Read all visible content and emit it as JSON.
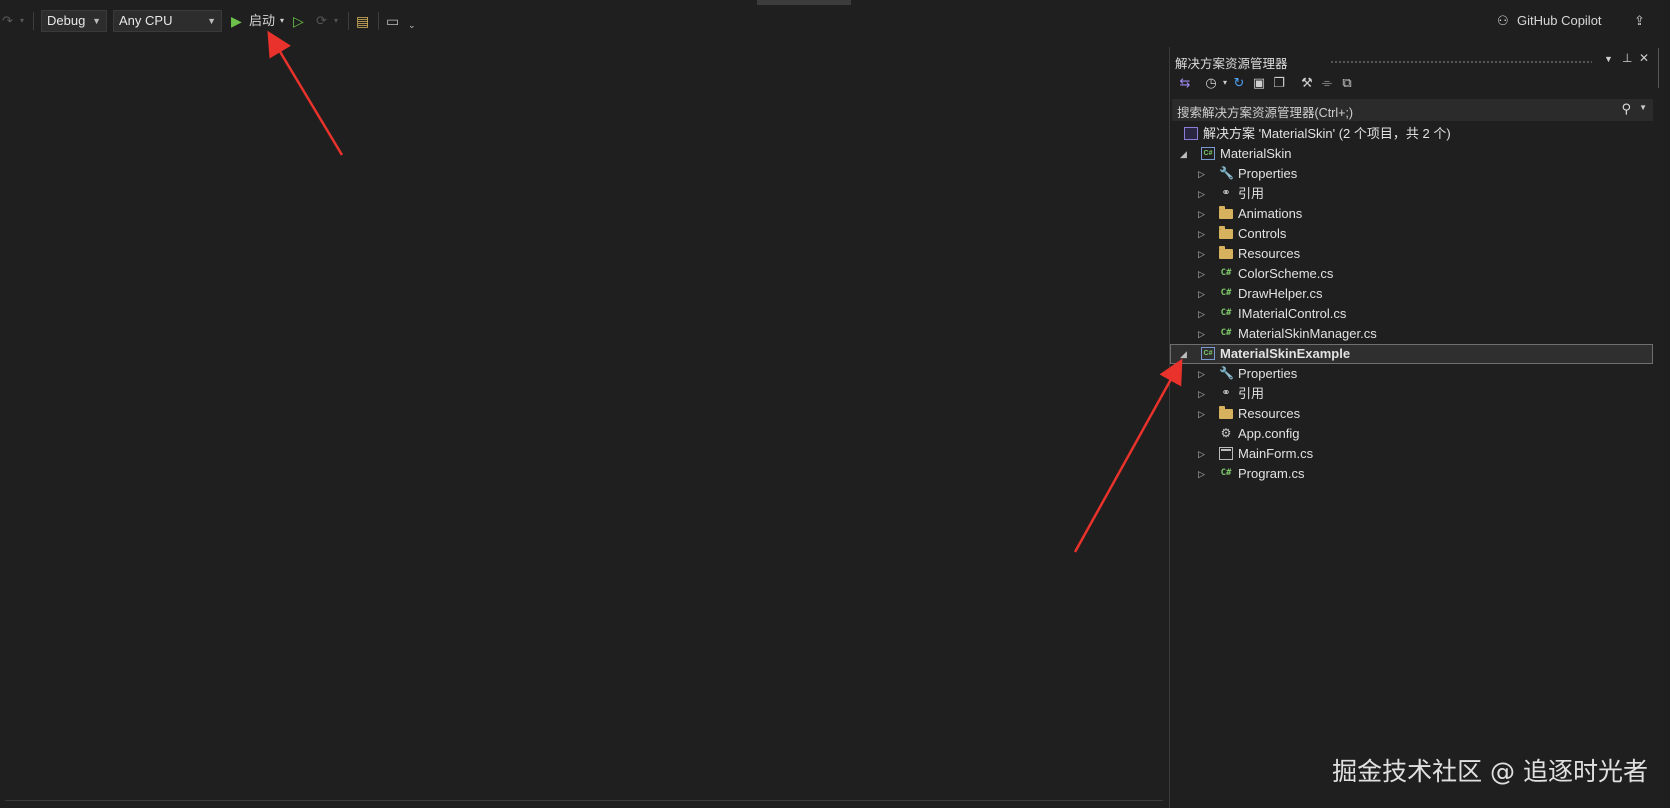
{
  "toolbar": {
    "config_select": "Debug",
    "platform_select": "Any CPU",
    "start_label": "启动",
    "copilot_label": "GitHub Copilot"
  },
  "solution_explorer": {
    "title": "解决方案资源管理器",
    "search_placeholder": "搜索解决方案资源管理器(Ctrl+;)",
    "tree": [
      {
        "label": "解决方案 'MaterialSkin' (2 个项目，共 2 个)",
        "icon": "solution-icon",
        "level": 0,
        "toggle": "none"
      },
      {
        "label": "MaterialSkin",
        "icon": "csharp-project-icon",
        "level": 1,
        "toggle": "expanded"
      },
      {
        "label": "Properties",
        "icon": "wrench-icon",
        "level": 2,
        "toggle": "collapsed"
      },
      {
        "label": "引用",
        "icon": "references-icon",
        "level": 2,
        "toggle": "collapsed"
      },
      {
        "label": "Animations",
        "icon": "folder-icon",
        "level": 2,
        "toggle": "collapsed"
      },
      {
        "label": "Controls",
        "icon": "folder-icon",
        "level": 2,
        "toggle": "collapsed"
      },
      {
        "label": "Resources",
        "icon": "folder-icon",
        "level": 2,
        "toggle": "collapsed"
      },
      {
        "label": "ColorScheme.cs",
        "icon": "csharp-file-icon",
        "level": 2,
        "toggle": "collapsed"
      },
      {
        "label": "DrawHelper.cs",
        "icon": "csharp-file-icon",
        "level": 2,
        "toggle": "collapsed"
      },
      {
        "label": "IMaterialControl.cs",
        "icon": "csharp-file-icon",
        "level": 2,
        "toggle": "collapsed"
      },
      {
        "label": "MaterialSkinManager.cs",
        "icon": "csharp-file-icon",
        "level": 2,
        "toggle": "collapsed"
      },
      {
        "label": "MaterialSkinExample",
        "icon": "csharp-project-icon",
        "level": 1,
        "toggle": "expanded",
        "selected": true,
        "bold": true
      },
      {
        "label": "Properties",
        "icon": "wrench-icon",
        "level": 2,
        "toggle": "collapsed"
      },
      {
        "label": "引用",
        "icon": "references-icon",
        "level": 2,
        "toggle": "collapsed"
      },
      {
        "label": "Resources",
        "icon": "folder-icon",
        "level": 2,
        "toggle": "collapsed"
      },
      {
        "label": "App.config",
        "icon": "config-file-icon",
        "level": 2,
        "toggle": "none"
      },
      {
        "label": "MainForm.cs",
        "icon": "form-file-icon",
        "level": 2,
        "toggle": "collapsed"
      },
      {
        "label": "Program.cs",
        "icon": "csharp-file-icon",
        "level": 2,
        "toggle": "collapsed"
      }
    ]
  },
  "watermark": "掘金技术社区 @ 追逐时光者",
  "colors": {
    "background": "#1f1f1f",
    "accent": "#8272d4",
    "annotation_arrow": "#e8322b",
    "run_green": "#6cc24a"
  }
}
